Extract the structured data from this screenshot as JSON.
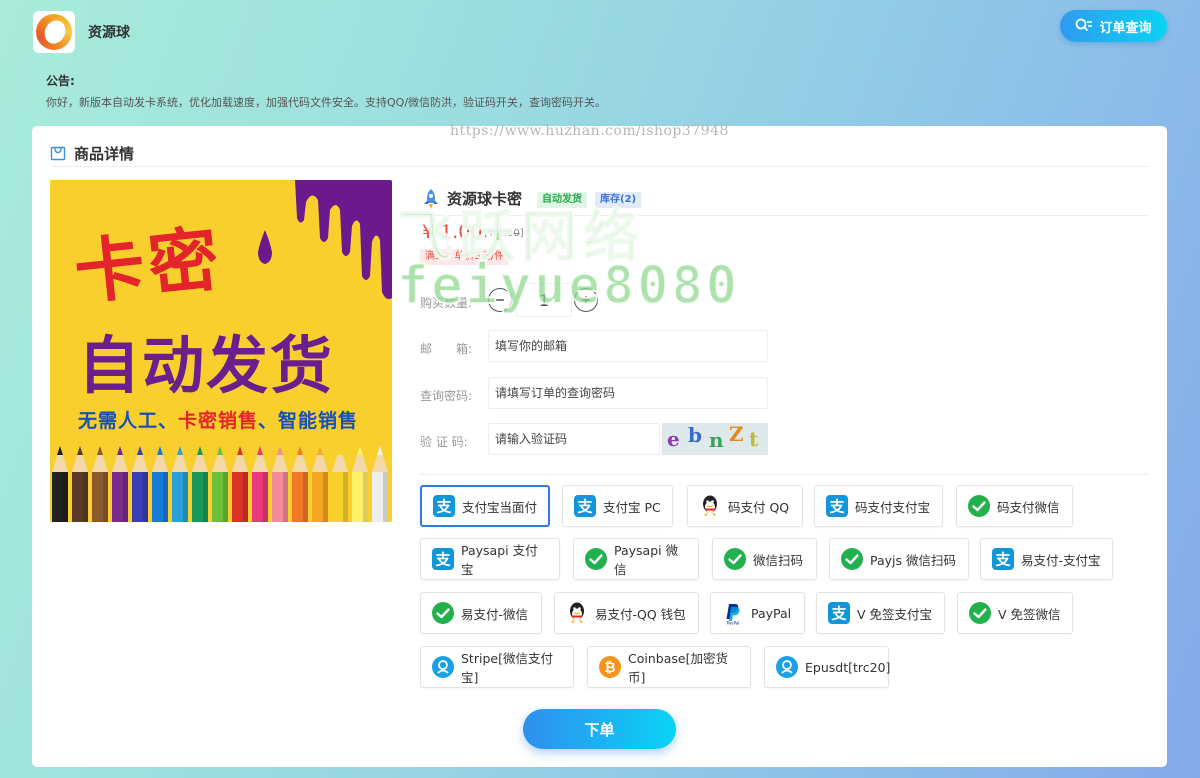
{
  "site": {
    "name": "资源球"
  },
  "header": {
    "order_query_label": "订单查询"
  },
  "notice": {
    "title": "公告:",
    "text": "你好，新版本自动发卡系统，优化加载速度，加强代码文件安全。支持QQ/微信防洪，验证码开关，查询密码开关。"
  },
  "watermark_url": "https://www.huzhan.com/ishop37948",
  "card": {
    "title": "商品详情"
  },
  "product_image": {
    "line1": "卡密",
    "line2": "自动发货",
    "line3_a": "无需人工、",
    "line3_b": "卡密销售",
    "line3_c": "、智能销售"
  },
  "product": {
    "title": "资源球卡密",
    "tag_auto": "自动发货",
    "tag_stock": "库存(2)",
    "price": "¥ 1.00",
    "price_old_prefix": "[",
    "price_old": "¥ 1.00",
    "price_old_suffix": "]",
    "discount": "满5个 单价3元/件"
  },
  "form": {
    "qty_label": "购买数量:",
    "qty_value": "1",
    "email_label": "邮　　箱:",
    "email_placeholder": "填写你的邮箱",
    "pwd_label": "查询密码:",
    "pwd_placeholder": "请填写订单的查询密码",
    "captcha_label": "验 证 码:",
    "captcha_placeholder": "请输入验证码",
    "captcha_chars": [
      "e",
      "b",
      "n",
      "Z",
      "t"
    ]
  },
  "brand_watermark": {
    "line1": "飞跃网络",
    "line2": "feiyue8080"
  },
  "payments": [
    {
      "label": "支付宝当面付",
      "icon": "alipay-icon",
      "active": true
    },
    {
      "label": "支付宝 PC",
      "icon": "alipay-icon"
    },
    {
      "label": "码支付 QQ",
      "icon": "qq-icon"
    },
    {
      "label": "码支付支付宝",
      "icon": "alipay-icon"
    },
    {
      "label": "码支付微信",
      "icon": "wechat-icon"
    },
    {
      "label": "Paysapi 支付宝",
      "icon": "alipay-icon"
    },
    {
      "label": "Paysapi 微信",
      "icon": "wechat-icon"
    },
    {
      "label": "微信扫码",
      "icon": "wechat-icon"
    },
    {
      "label": "Payjs 微信扫码",
      "icon": "wechat-icon"
    },
    {
      "label": "易支付-支付宝",
      "icon": "alipay-icon"
    },
    {
      "label": "易支付-微信",
      "icon": "wechat-icon"
    },
    {
      "label": "易支付-QQ 钱包",
      "icon": "qq-icon"
    },
    {
      "label": "PayPal",
      "icon": "paypal-icon"
    },
    {
      "label": "V 免签支付宝",
      "icon": "alipay-icon"
    },
    {
      "label": "V 免签微信",
      "icon": "wechat-icon"
    },
    {
      "label": "Stripe[微信支付宝]",
      "icon": "stripe-icon"
    },
    {
      "label": "Coinbase[加密货币]",
      "icon": "bitcoin-icon"
    },
    {
      "label": "Epusdt[trc20]",
      "icon": "epusdt-icon"
    }
  ],
  "colors": {
    "accent": "#2f8fee",
    "price_red": "#e74c3c",
    "alipay_blue": "#1296db",
    "wechat_green": "#22b14c"
  },
  "submit_label": "下单"
}
